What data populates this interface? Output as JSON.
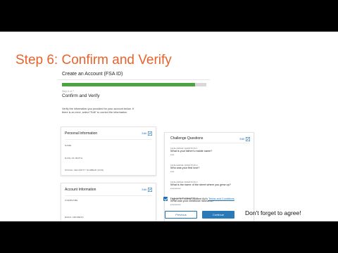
{
  "slide": {
    "title": "Step 6: Confirm and Verify",
    "note": "Don't forget to agree!"
  },
  "form": {
    "header": "Create an Account (FSA ID)",
    "progress": 0.92,
    "step_of": "Step 6 of 7",
    "subtitle": "Confirm and Verify",
    "verify_text_1": "Verify the information you provided for your account below. If",
    "verify_text_2": "there is an error, select \"Edit\" to correct the information."
  },
  "personal": {
    "title": "Personal Information",
    "edit_label": "Edit",
    "name_label": "Name",
    "dob_label": "Date of Birth",
    "ssn_label": "Social Security Number (SSN)"
  },
  "account": {
    "title": "Account Information",
    "edit_label": "Edit",
    "username_label": "Username",
    "email_label": "Email Address"
  },
  "challenge": {
    "title": "Challenge Questions",
    "edit_label": "Edit",
    "items": [
      {
        "label": "Challenge Question 1",
        "question": "What is your father's middle name?",
        "answer": "***"
      },
      {
        "label": "Challenge Question 2",
        "question": "Who was your first love?",
        "answer": "***"
      },
      {
        "label": "Challenge Question 3",
        "question": "What is the name of the street where you grew up?",
        "answer": "********"
      },
      {
        "label": "Challenge Question 4",
        "question": "What was your childhood nickname?",
        "answer": "********"
      }
    ]
  },
  "agree": {
    "text": "I agree to Federal Student Aid's",
    "link": "Terms and Conditions",
    "checked": true
  },
  "buttons": {
    "previous": "Previous",
    "continue": "Continue"
  },
  "colors": {
    "title_orange": "#e8632b",
    "progress_green": "#4aa53e",
    "link_blue": "#1f6fb5",
    "button_blue": "#2a7ab8"
  },
  "icons": {
    "edit": "pencil-edit-icon",
    "checkbox": "checkmark-icon"
  }
}
